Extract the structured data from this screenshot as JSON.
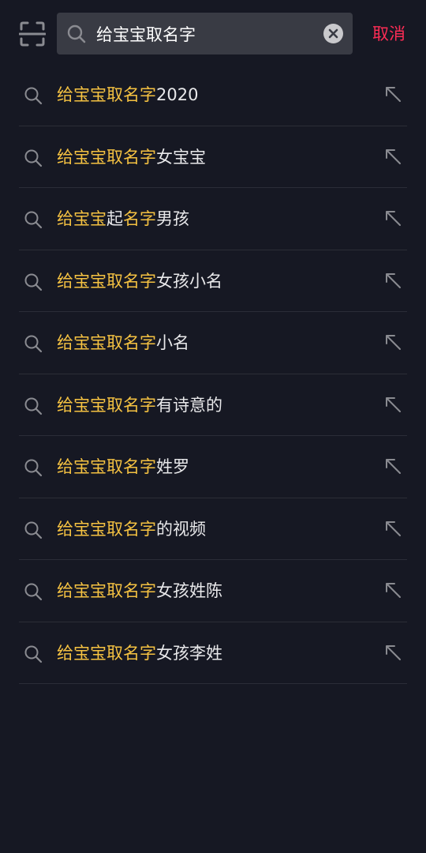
{
  "search": {
    "value": "给宝宝取名字",
    "placeholder": ""
  },
  "header": {
    "cancel_label": "取消"
  },
  "colors": {
    "background": "#161823",
    "search_box": "#393b44",
    "highlight": "#f5c242",
    "cancel": "#fe2c55",
    "text": "#e8e8ea",
    "icon": "#8a8b91"
  },
  "icons": {
    "scan": "scan-icon",
    "search": "search-icon",
    "clear": "clear-icon",
    "fill_query": "arrow-up-left-icon"
  },
  "suggestions": [
    {
      "parts": [
        {
          "text": "给宝宝取名字",
          "hl": true
        },
        {
          "text": "2020",
          "hl": false
        }
      ]
    },
    {
      "parts": [
        {
          "text": "给宝宝取名字",
          "hl": true
        },
        {
          "text": "女宝宝",
          "hl": false
        }
      ]
    },
    {
      "parts": [
        {
          "text": "给宝宝",
          "hl": true
        },
        {
          "text": "起",
          "hl": false
        },
        {
          "text": "名字",
          "hl": true
        },
        {
          "text": "男孩",
          "hl": false
        }
      ]
    },
    {
      "parts": [
        {
          "text": "给宝宝取名字",
          "hl": true
        },
        {
          "text": "女孩小名",
          "hl": false
        }
      ]
    },
    {
      "parts": [
        {
          "text": "给宝宝取名字",
          "hl": true
        },
        {
          "text": "小名",
          "hl": false
        }
      ]
    },
    {
      "parts": [
        {
          "text": "给宝宝取名字",
          "hl": true
        },
        {
          "text": "有诗意的",
          "hl": false
        }
      ]
    },
    {
      "parts": [
        {
          "text": "给宝宝取名字",
          "hl": true
        },
        {
          "text": "姓罗",
          "hl": false
        }
      ]
    },
    {
      "parts": [
        {
          "text": "给宝宝取名字",
          "hl": true
        },
        {
          "text": "的视频",
          "hl": false
        }
      ]
    },
    {
      "parts": [
        {
          "text": "给宝宝取名字",
          "hl": true
        },
        {
          "text": "女孩姓陈",
          "hl": false
        }
      ]
    },
    {
      "parts": [
        {
          "text": "给宝宝取名字",
          "hl": true
        },
        {
          "text": "女孩李姓",
          "hl": false
        }
      ]
    }
  ]
}
